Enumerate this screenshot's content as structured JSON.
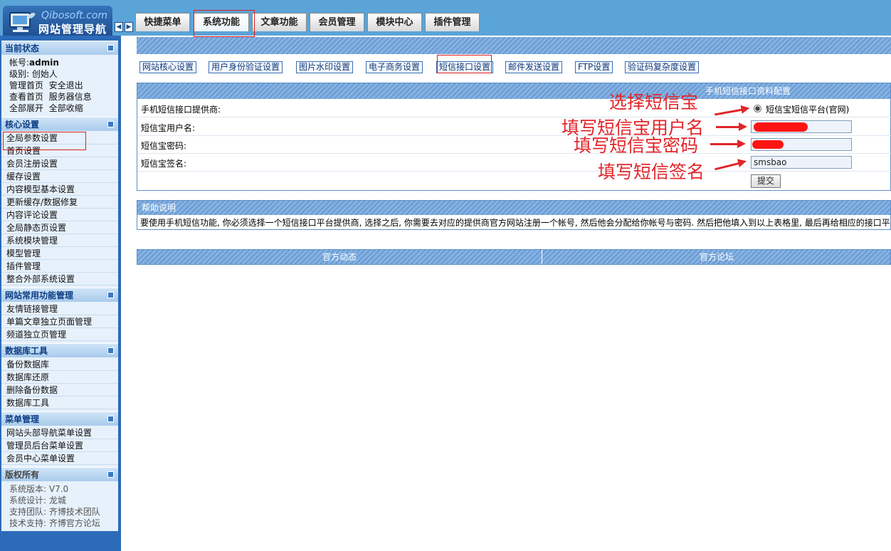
{
  "logo": {
    "site": "Qibosoft.com",
    "title": "网站管理导航"
  },
  "top_tabs": [
    {
      "label": "快捷菜单"
    },
    {
      "label": "系统功能"
    },
    {
      "label": "文章功能"
    },
    {
      "label": "会员管理"
    },
    {
      "label": "模块中心"
    },
    {
      "label": "插件管理"
    }
  ],
  "active_tab": "系统功能",
  "sidebar": {
    "status": {
      "title": "当前状态",
      "account_label": "帐号:",
      "account_value": "admin",
      "level_label": "级别:",
      "level_value": "创始人",
      "links_row1": "管理首页  安全退出",
      "links_row2": "查看首页  服务器信息",
      "links_row3": "全部展开  全部收缩"
    },
    "core": {
      "title": "核心设置",
      "items": [
        "全局参数设置",
        "首页设置",
        "会员注册设置",
        "缓存设置",
        "内容模型基本设置",
        "更新缓存/数据修复",
        "内容评论设置",
        "全局静态页设置",
        "系统模块管理",
        "模型管理",
        "插件管理",
        "整合外部系统设置"
      ]
    },
    "common": {
      "title": "网站常用功能管理",
      "items": [
        "友情链接管理",
        "单篇文章独立页面管理",
        "频道独立页管理"
      ]
    },
    "db": {
      "title": "数据库工具",
      "items": [
        "备份数据库",
        "数据库还原",
        "删除备份数据",
        "数据库工具"
      ]
    },
    "menu": {
      "title": "菜单管理",
      "items": [
        "网站头部导航菜单设置",
        "管理员后台菜单设置",
        "会员中心菜单设置"
      ]
    },
    "copyright": {
      "title": "版权所有",
      "lines": [
        "系统版本: V7.0",
        "系统设计: 龙城",
        "支持团队: 齐博技术团队",
        "技术支持: 齐博官方论坛"
      ]
    }
  },
  "subnav": [
    "网站核心设置",
    "用户身份验证设置",
    "图片水印设置",
    "电子商务设置",
    "短信接口设置",
    "邮件发送设置",
    "FTP设置",
    "验证码复杂度设置"
  ],
  "active_subnav": "短信接口设置",
  "sms_config": {
    "header": "手机短信接口资料配置",
    "provider_label": "手机短信接口提供商:",
    "provider_option": "短信宝短信平台(官网)",
    "username_label": "短信宝用户名:",
    "password_label": "短信宝密码:",
    "signature_label": "短信宝签名:",
    "signature_value": "smsbao",
    "submit_label": "提交"
  },
  "help": {
    "header": "帮助说明",
    "text": "要使用手机短信功能, 你必须选择一个短信接口平台提供商, 选择之后, 你需要去对应的提供商官方网站注册一个帐号, 然后他会分配给你帐号与密码. 然后把他填入到以上表格里, 最后再给相应的接口平台"
  },
  "bottom": {
    "left": "官方动态",
    "right": "官方论坛"
  },
  "annotations": {
    "select": "选择短信宝",
    "username": "填写短信宝用户名",
    "password": "填写短信宝密码",
    "signature": "填写短信签名"
  },
  "colors": {
    "accent": "#5ba4d8",
    "sidebar": "#2c6bb8",
    "annotation": "#e0262a"
  }
}
